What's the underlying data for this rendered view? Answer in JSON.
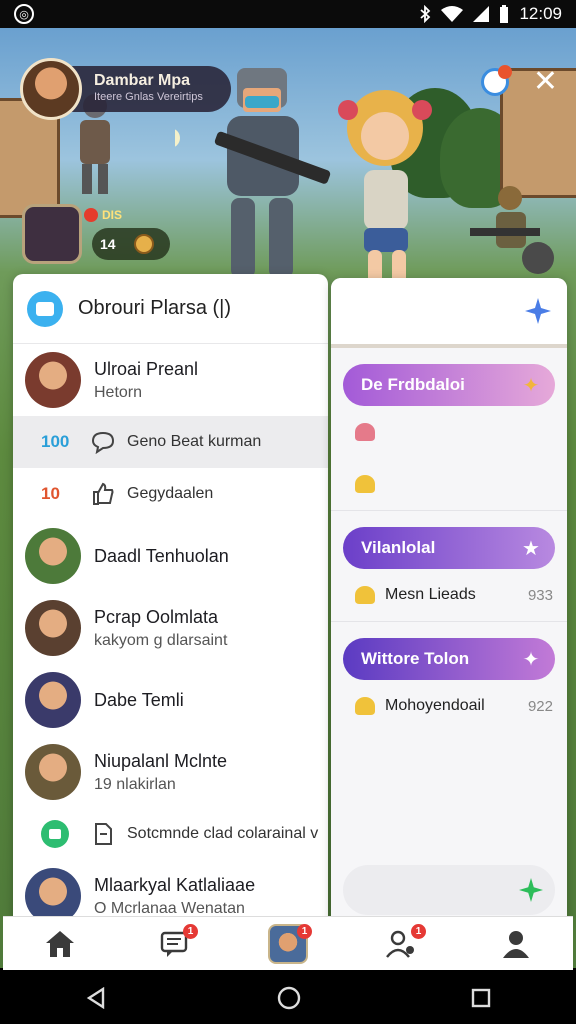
{
  "status_bar": {
    "time": "12:09"
  },
  "hud": {
    "player_name": "Dambar Mpa",
    "player_subtitle": "Iteere Gnlas Vereirtips",
    "badge_value": "DIS",
    "counter_value": "14"
  },
  "left_panel": {
    "title": "Obrouri Plarsa (|)",
    "rows": [
      {
        "type": "contact",
        "name": "Ulroai Preanl",
        "status": "Hetorn",
        "avatar_color": "#7a3b2e"
      },
      {
        "type": "sub",
        "num": "100",
        "num_color": "#2a9fd8",
        "icon": "chat-bubble-icon",
        "text": "Geno Beat kurman",
        "highlight": true
      },
      {
        "type": "sub",
        "num": "10",
        "num_color": "#e0552f",
        "icon": "thumbs-up-icon",
        "text": "Gegydaalen",
        "highlight": false
      },
      {
        "type": "contact",
        "name": "Daadl Tenhuolan",
        "status": "",
        "avatar_color": "#4d7a3a"
      },
      {
        "type": "contact",
        "name": "Pcrap Oolmlata",
        "status": "kakyom g dlarsaint",
        "avatar_color": "#5a4030"
      },
      {
        "type": "contact",
        "name": "Dabe Temli",
        "status": "",
        "avatar_color": "#3a3a6a"
      },
      {
        "type": "contact",
        "name": "Niupalanl Mclnte",
        "status": "19 nlakirlan",
        "avatar_color": "#6a5a3a"
      },
      {
        "type": "green-sub",
        "icon": "document-icon",
        "text": "Sotcmnde clad colarainal v"
      },
      {
        "type": "contact",
        "name": "Mlaarkyal Katlaliaae",
        "status": "O Mcrlanaa Wenatan",
        "avatar_color": "#3a4a7a"
      }
    ]
  },
  "right_panel": {
    "sections": [
      {
        "pill": "De Frdbdaloi",
        "pill_gradient": [
          "#a35ad8",
          "#e6a9d9"
        ],
        "star": "✦",
        "star_color": "#f2b53c",
        "lines": [
          {
            "text": "",
            "icon_color": "#e57a8a",
            "value": ""
          },
          {
            "text": "",
            "icon_color": "#f0c23a",
            "value": ""
          }
        ]
      },
      {
        "pill": "Vilanlolal",
        "pill_gradient": [
          "#6b3fc9",
          "#b889e0"
        ],
        "star": "★",
        "star_color": "#ffffff",
        "lines": [
          {
            "text": "Mesn Lieads",
            "icon_color": "#f0c23a",
            "value": "933"
          }
        ]
      },
      {
        "pill": "Wittore Tolon",
        "pill_gradient": [
          "#5b3bc2",
          "#c27ad7"
        ],
        "star": "✦",
        "star_color": "#ffffff",
        "lines": [
          {
            "text": "Mohoyendoail",
            "icon_color": "#f0c23a",
            "value": "922"
          }
        ]
      }
    ]
  },
  "bottom_nav": {
    "items": [
      {
        "name": "home-icon",
        "badge": ""
      },
      {
        "name": "messages-icon",
        "badge": "1"
      },
      {
        "name": "profile-avatar",
        "badge": "1"
      },
      {
        "name": "friends-icon",
        "badge": "1"
      },
      {
        "name": "account-icon",
        "badge": ""
      }
    ]
  }
}
